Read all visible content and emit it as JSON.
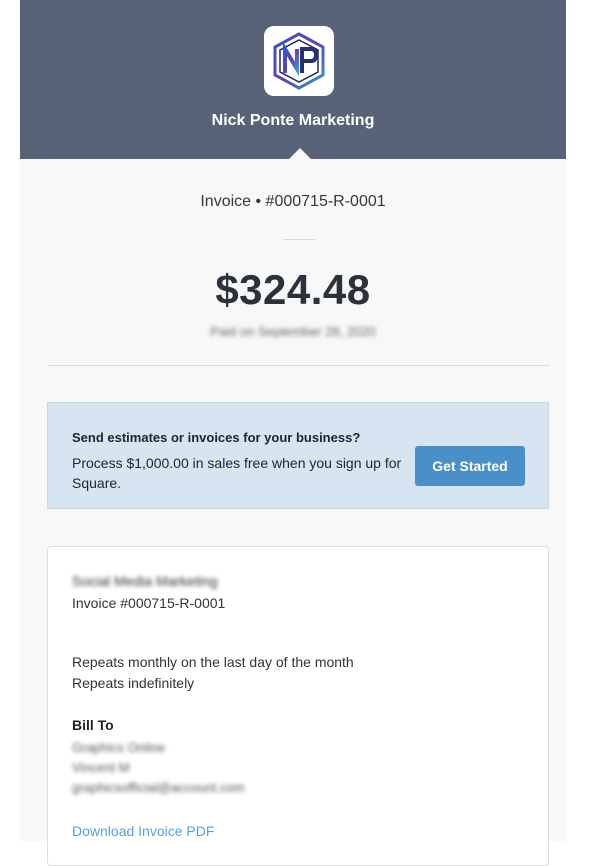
{
  "header": {
    "business_name": "Nick Ponte Marketing",
    "logo_letters": "NP",
    "background_color": "#586377"
  },
  "summary": {
    "invoice_title": "Invoice • #000715-R-0001",
    "amount": "$324.48",
    "paid_on_blurred": "Paid on September 28, 2020"
  },
  "promo": {
    "title": "Send estimates or invoices for your business?",
    "text": "Process $1,000.00 in sales free when you sign up for Square.",
    "button_label": "Get Started",
    "button_color": "#4a90c8",
    "background_color": "#d6e5f1"
  },
  "details": {
    "business_name_blurred": "Social Media Marketing",
    "invoice_number": "Invoice #000715-R-0001",
    "repeat_schedule": "Repeats monthly on the last day of the month",
    "repeat_duration": "Repeats indefinitely",
    "bill_to_label": "Bill To",
    "bill_to_lines_blurred": [
      "Graphics Online",
      "Vincent M",
      "graphicsofficial@account.com"
    ],
    "download_link": "Download Invoice PDF",
    "link_color": "#5aa0d8"
  }
}
